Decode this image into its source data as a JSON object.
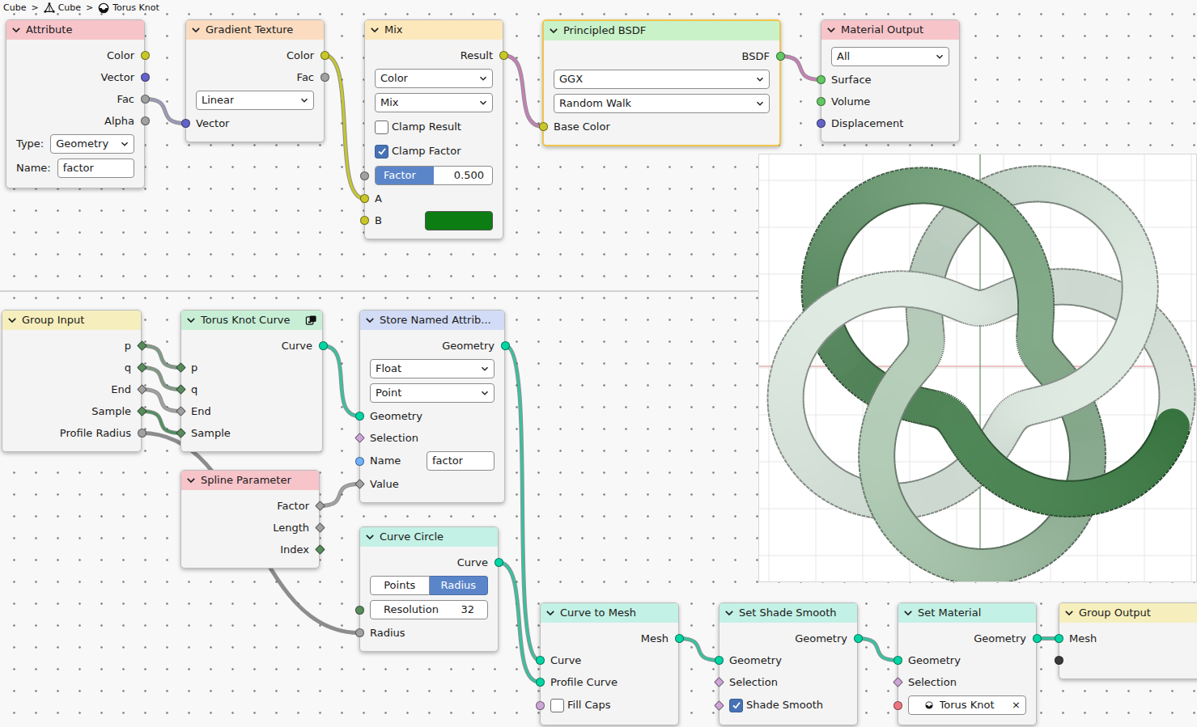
{
  "breadcrumb": {
    "separator": ">",
    "items": [
      {
        "label": "Cube",
        "kind": "object"
      },
      {
        "label": "Cube",
        "kind": "mesh"
      },
      {
        "label": "Torus Knot",
        "kind": "material"
      }
    ]
  },
  "nodes": [
    {
      "title": "Attribute",
      "color": "#f7c4ca",
      "kind": "node",
      "selected": false,
      "rows": [
        {
          "kind": "output",
          "label": "Color",
          "socket": {
            "shape": "circle",
            "color": "#c7c729"
          }
        },
        {
          "kind": "output",
          "label": "Vector",
          "socket": {
            "shape": "circle",
            "color": "#6363c7"
          }
        },
        {
          "kind": "output",
          "label": "Fac",
          "socket": {
            "shape": "circle",
            "color": "#a1a1a1"
          }
        },
        {
          "kind": "output",
          "label": "Alpha",
          "socket": {
            "shape": "circle",
            "color": "#a1a1a1"
          }
        },
        {
          "kind": "dropdown",
          "label": "Type:",
          "value": "Geometry"
        },
        {
          "kind": "field",
          "label": "Name:",
          "value": "factor"
        }
      ]
    },
    {
      "title": "Gradient Texture",
      "color": "#fbdcc0",
      "kind": "node",
      "selected": false,
      "rows": [
        {
          "kind": "output",
          "label": "Color",
          "socket": {
            "shape": "circle",
            "color": "#c7c729"
          }
        },
        {
          "kind": "output",
          "label": "Fac",
          "socket": {
            "shape": "circle",
            "color": "#a1a1a1"
          }
        },
        {
          "kind": "dropdown",
          "value": "Linear"
        },
        {
          "kind": "input",
          "label": "Vector",
          "socket": {
            "shape": "circle",
            "color": "#6363c7"
          }
        }
      ]
    },
    {
      "title": "Mix",
      "color": "#fde8bb",
      "kind": "node",
      "selected": false,
      "rows": [
        {
          "kind": "output",
          "label": "Result",
          "socket": {
            "shape": "circle",
            "color": "#c7c729"
          }
        },
        {
          "kind": "dropdown",
          "value": "Color"
        },
        {
          "kind": "dropdown",
          "value": "Mix"
        },
        {
          "kind": "checkbox",
          "label": "Clamp Result",
          "checked": false
        },
        {
          "kind": "checkbox",
          "label": "Clamp Factor",
          "checked": true
        },
        {
          "kind": "slider",
          "label": "Factor",
          "value": "0.500",
          "level": 0.5,
          "socket": {
            "shape": "circle",
            "color": "#a1a1a1"
          }
        },
        {
          "kind": "input",
          "label": "A",
          "socket": {
            "shape": "circle",
            "color": "#c7c729"
          }
        },
        {
          "kind": "color",
          "label": "B",
          "swatch": "#0b7d12",
          "socket": {
            "shape": "circle",
            "color": "#c7c729"
          }
        }
      ]
    },
    {
      "title": "Principled BSDF",
      "color": "#c9f2c9",
      "kind": "node",
      "selected": true,
      "rows": [
        {
          "kind": "output",
          "label": "BSDF",
          "socket": {
            "shape": "circle",
            "color": "#63c763"
          }
        },
        {
          "kind": "dropdown",
          "value": "GGX"
        },
        {
          "kind": "dropdown",
          "value": "Random Walk"
        },
        {
          "kind": "input",
          "label": "Base Color",
          "socket": {
            "shape": "circle",
            "color": "#c7c729"
          }
        }
      ]
    },
    {
      "title": "Material Output",
      "color": "#f7c4ca",
      "kind": "node",
      "selected": false,
      "rows": [
        {
          "kind": "dropdown",
          "value": "All"
        },
        {
          "kind": "input",
          "label": "Surface",
          "socket": {
            "shape": "circle",
            "color": "#63c763"
          }
        },
        {
          "kind": "input",
          "label": "Volume",
          "socket": {
            "shape": "circle",
            "color": "#63c763"
          }
        },
        {
          "kind": "input",
          "label": "Displacement",
          "socket": {
            "shape": "circle",
            "color": "#6363c7"
          }
        }
      ]
    },
    {
      "title": "Group Input",
      "color": "#f6efbd",
      "kind": "node",
      "selected": false,
      "rows": [
        {
          "kind": "output",
          "label": "p",
          "socket": {
            "shape": "diamond",
            "color": "#598c5c"
          }
        },
        {
          "kind": "output",
          "label": "q",
          "socket": {
            "shape": "diamond",
            "color": "#598c5c"
          }
        },
        {
          "kind": "output",
          "label": "End",
          "socket": {
            "shape": "diamond",
            "color": "#a1a1a1"
          }
        },
        {
          "kind": "output",
          "label": "Sample",
          "socket": {
            "shape": "diamond",
            "color": "#598c5c"
          }
        },
        {
          "kind": "output",
          "label": "Profile Radius",
          "socket": {
            "shape": "circle",
            "color": "#a1a1a1"
          }
        }
      ]
    },
    {
      "title": "Torus Knot Curve",
      "color": "#c8efd6",
      "kind": "group",
      "selected": false,
      "rows": [
        {
          "kind": "output",
          "label": "Curve",
          "socket": {
            "shape": "circle",
            "color": "#00d6a3"
          }
        },
        {
          "kind": "input",
          "label": "p",
          "socket": {
            "shape": "diamond",
            "color": "#598c5c"
          }
        },
        {
          "kind": "input",
          "label": "q",
          "socket": {
            "shape": "diamond",
            "color": "#598c5c"
          }
        },
        {
          "kind": "input",
          "label": "End",
          "socket": {
            "shape": "diamond",
            "color": "#a1a1a1"
          }
        },
        {
          "kind": "input",
          "label": "Sample",
          "socket": {
            "shape": "diamond",
            "color": "#598c5c"
          }
        }
      ]
    },
    {
      "title": "Spline Parameter",
      "color": "#f7c4ca",
      "kind": "node",
      "selected": false,
      "rows": [
        {
          "kind": "output",
          "label": "Factor",
          "socket": {
            "shape": "diamond",
            "color": "#a1a1a1"
          }
        },
        {
          "kind": "output",
          "label": "Length",
          "socket": {
            "shape": "diamond",
            "color": "#a1a1a1"
          }
        },
        {
          "kind": "output",
          "label": "Index",
          "socket": {
            "shape": "diamond",
            "color": "#598c5c"
          }
        }
      ]
    },
    {
      "title": "Store Named Attrib...",
      "color": "#d3dcf6",
      "kind": "node",
      "selected": false,
      "rows": [
        {
          "kind": "output",
          "label": "Geometry",
          "socket": {
            "shape": "circle",
            "color": "#00d6a3"
          }
        },
        {
          "kind": "dropdown",
          "value": "Float"
        },
        {
          "kind": "dropdown",
          "value": "Point"
        },
        {
          "kind": "input",
          "label": "Geometry",
          "socket": {
            "shape": "circle",
            "color": "#00d6a3"
          }
        },
        {
          "kind": "input",
          "label": "Selection",
          "socket": {
            "shape": "diamond",
            "color": "#cca6d6"
          }
        },
        {
          "kind": "field",
          "label": "Name",
          "value": "factor",
          "socket": {
            "shape": "circle",
            "color": "#70b2ff"
          }
        },
        {
          "kind": "input",
          "label": "Value",
          "socket": {
            "shape": "diamond",
            "color": "#a1a1a1"
          }
        }
      ]
    },
    {
      "title": "Curve Circle",
      "color": "#c3f1e5",
      "kind": "node",
      "selected": false,
      "rows": [
        {
          "kind": "output",
          "label": "Curve",
          "socket": {
            "shape": "circle",
            "color": "#00d6a3"
          }
        },
        {
          "kind": "toggle",
          "options": [
            {
              "label": "Points",
              "selected": false
            },
            {
              "label": "Radius",
              "selected": true
            }
          ]
        },
        {
          "kind": "number",
          "label": "Resolution",
          "value": "32",
          "socket": {
            "shape": "circle",
            "color": "#598c5c"
          }
        },
        {
          "kind": "input",
          "label": "Radius",
          "socket": {
            "shape": "circle",
            "color": "#a1a1a1"
          }
        }
      ]
    },
    {
      "title": "Curve to Mesh",
      "color": "#c3f1e5",
      "kind": "node",
      "selected": false,
      "rows": [
        {
          "kind": "output",
          "label": "Mesh",
          "socket": {
            "shape": "circle",
            "color": "#00d6a3"
          }
        },
        {
          "kind": "input",
          "label": "Curve",
          "socket": {
            "shape": "circle",
            "color": "#00d6a3"
          }
        },
        {
          "kind": "input",
          "label": "Profile Curve",
          "socket": {
            "shape": "circle",
            "color": "#00d6a3"
          }
        },
        {
          "kind": "checkbox",
          "label": "Fill Caps",
          "checked": false,
          "socket": {
            "shape": "circle",
            "color": "#cca6d6"
          }
        }
      ]
    },
    {
      "title": "Set Shade Smooth",
      "color": "#c3f1e5",
      "kind": "node",
      "selected": false,
      "rows": [
        {
          "kind": "output",
          "label": "Geometry",
          "socket": {
            "shape": "circle",
            "color": "#00d6a3"
          }
        },
        {
          "kind": "input",
          "label": "Geometry",
          "socket": {
            "shape": "circle",
            "color": "#00d6a3"
          }
        },
        {
          "kind": "input",
          "label": "Selection",
          "socket": {
            "shape": "diamond",
            "color": "#cca6d6"
          }
        },
        {
          "kind": "checkbox",
          "label": "Shade Smooth",
          "checked": true,
          "socket": {
            "shape": "diamond",
            "color": "#cca6d6"
          }
        }
      ]
    },
    {
      "title": "Set Material",
      "color": "#c3f1e5",
      "kind": "node",
      "selected": false,
      "rows": [
        {
          "kind": "output",
          "label": "Geometry",
          "socket": {
            "shape": "circle",
            "color": "#00d6a3"
          }
        },
        {
          "kind": "input",
          "label": "Geometry",
          "socket": {
            "shape": "circle",
            "color": "#00d6a3"
          }
        },
        {
          "kind": "input",
          "label": "Selection",
          "socket": {
            "shape": "diamond",
            "color": "#cca6d6"
          }
        },
        {
          "kind": "material",
          "value": "Torus Knot",
          "clear": "×",
          "socket": {
            "shape": "circle",
            "color": "#eb7582"
          }
        }
      ]
    },
    {
      "title": "Group Output",
      "color": "#f6efbd",
      "kind": "node",
      "selected": false,
      "rows": [
        {
          "kind": "input",
          "label": "Mesh",
          "socket": {
            "shape": "circle",
            "color": "#00d6a3"
          }
        },
        {
          "kind": "socket",
          "socket": {
            "shape": "circle",
            "color": "#3a3a3a"
          }
        }
      ]
    }
  ],
  "links": [
    {
      "from": [
        0,
        2
      ],
      "to": [
        1,
        3
      ],
      "color": "#9a9ab8"
    },
    {
      "from": [
        1,
        0
      ],
      "to": [
        2,
        6
      ],
      "color": "#c7c72a"
    },
    {
      "from": [
        2,
        0
      ],
      "to": [
        3,
        3
      ],
      "color": "#c77fb6"
    },
    {
      "from": [
        3,
        0
      ],
      "to": [
        4,
        1
      ],
      "color": "#c77fb6"
    },
    {
      "from": [
        5,
        0
      ],
      "to": [
        6,
        1
      ],
      "color": "#7f9a84"
    },
    {
      "from": [
        5,
        1
      ],
      "to": [
        6,
        2
      ],
      "color": "#7f9a84"
    },
    {
      "from": [
        5,
        2
      ],
      "to": [
        6,
        3
      ],
      "color": "#a1a1a1"
    },
    {
      "from": [
        5,
        3
      ],
      "to": [
        6,
        4
      ],
      "color": "#4f8f5f"
    },
    {
      "from": [
        5,
        4
      ],
      "to": [
        9,
        3
      ],
      "color": "#8c8c8c"
    },
    {
      "from": [
        6,
        0
      ],
      "to": [
        8,
        3
      ],
      "color": "#36c2a0"
    },
    {
      "from": [
        7,
        0
      ],
      "to": [
        8,
        6
      ],
      "color": "#a1a1a1"
    },
    {
      "from": [
        8,
        0
      ],
      "to": [
        10,
        1
      ],
      "color": "#36c2a0"
    },
    {
      "from": [
        9,
        0
      ],
      "to": [
        10,
        2
      ],
      "color": "#36c2a0"
    },
    {
      "from": [
        10,
        0
      ],
      "to": [
        11,
        1
      ],
      "color": "#36c2a0"
    },
    {
      "from": [
        11,
        0
      ],
      "to": [
        12,
        1
      ],
      "color": "#36c2a0"
    },
    {
      "from": [
        12,
        0
      ],
      "to": [
        13,
        0
      ],
      "color": "#36c2a0"
    }
  ]
}
